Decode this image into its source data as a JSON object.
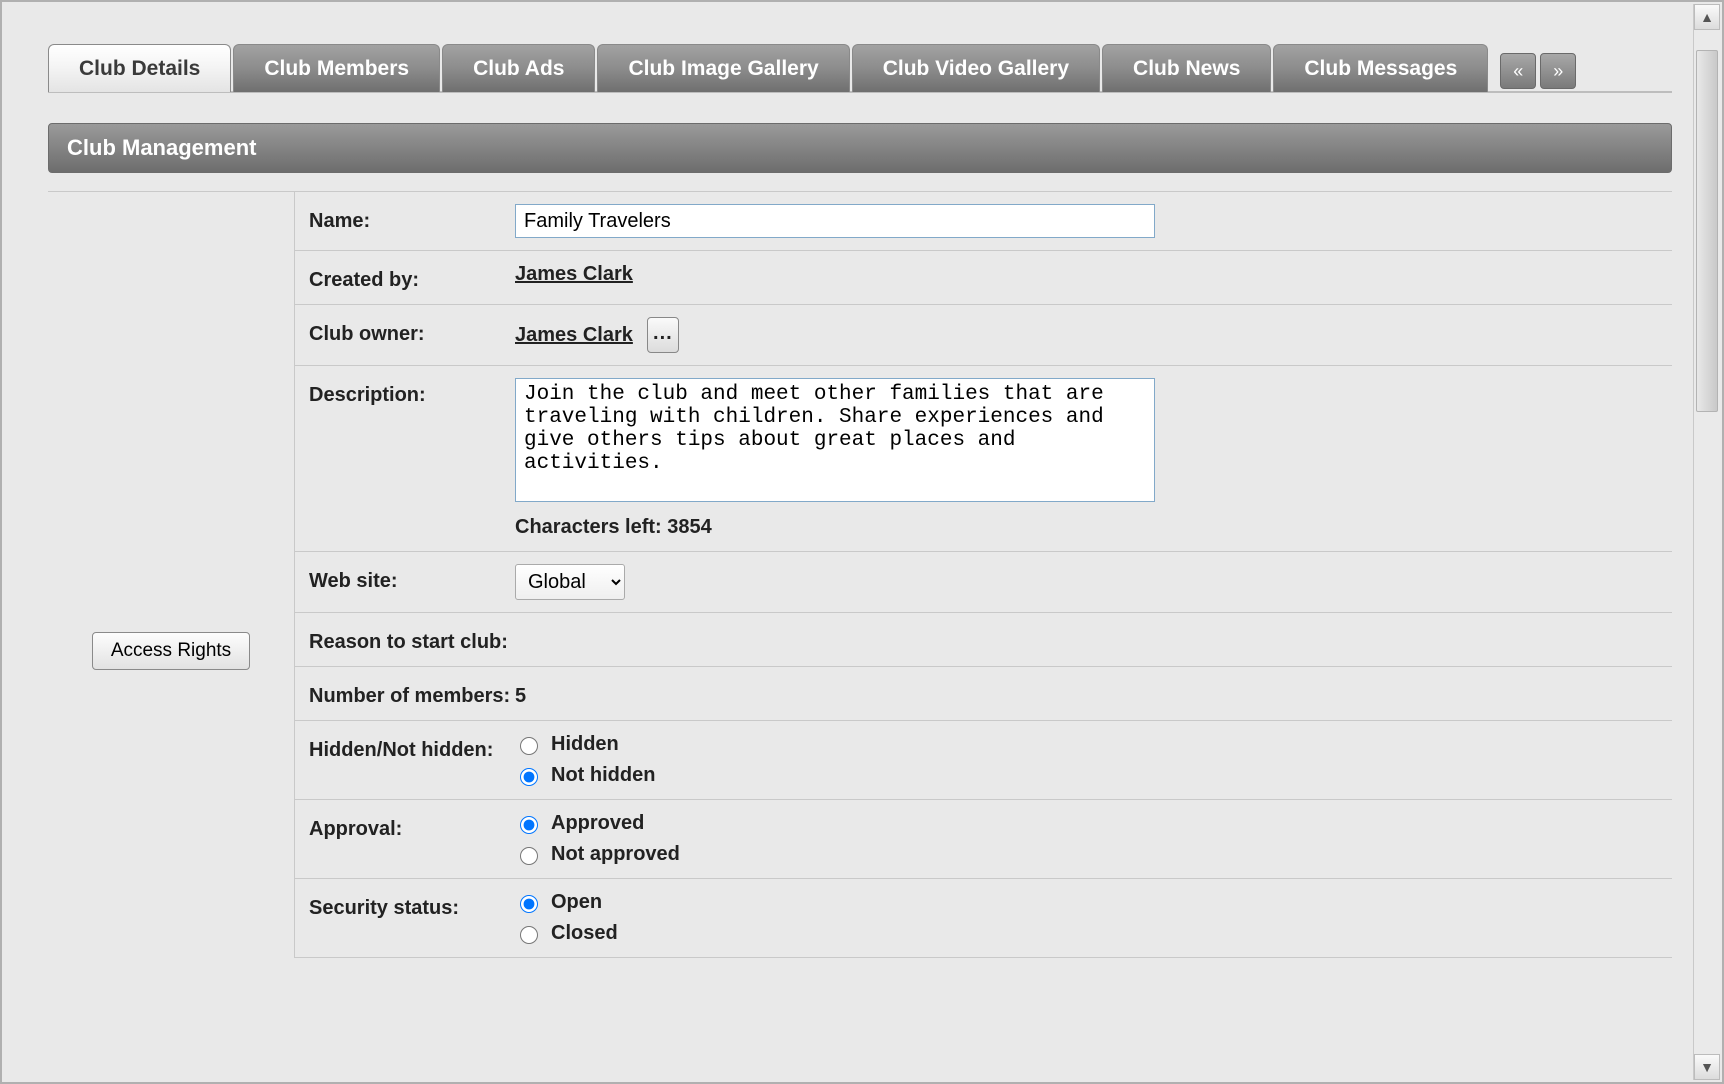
{
  "tabs": [
    {
      "label": "Club Details"
    },
    {
      "label": "Club Members"
    },
    {
      "label": "Club Ads"
    },
    {
      "label": "Club Image Gallery"
    },
    {
      "label": "Club Video Gallery"
    },
    {
      "label": "Club News"
    },
    {
      "label": "Club Messages"
    }
  ],
  "tab_nav": {
    "prev_glyph": "«",
    "next_glyph": "»"
  },
  "section_title": "Club Management",
  "side": {
    "access_rights_label": "Access Rights"
  },
  "form": {
    "name_label": "Name:",
    "name_value": "Family Travelers",
    "created_by_label": "Created by:",
    "created_by_value": "James Clark",
    "owner_label": "Club owner:",
    "owner_value": "James Clark",
    "ellipsis_glyph": "...",
    "description_label": "Description:",
    "description_value": "Join the club and meet other families that are traveling with children. Share experiences and give others tips about great places and activities.",
    "chars_left_label": "Characters left: 3854",
    "website_label": "Web site:",
    "website_selected": "Global",
    "reason_label": "Reason to start club:",
    "members_label": "Number of members:",
    "members_value": "5",
    "hidden_label": "Hidden/Not hidden:",
    "hidden_opt1": "Hidden",
    "hidden_opt2": "Not hidden",
    "approval_label": "Approval:",
    "approval_opt1": "Approved",
    "approval_opt2": "Not approved",
    "security_label": "Security status:",
    "security_opt1": "Open",
    "security_opt2": "Closed"
  },
  "scroll": {
    "up_glyph": "▲",
    "down_glyph": "▼"
  }
}
